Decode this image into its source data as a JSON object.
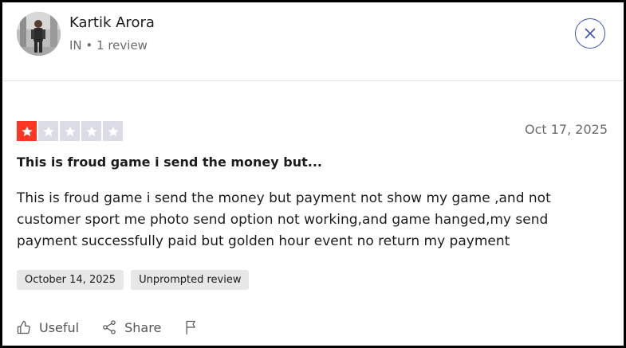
{
  "reviewer": {
    "name": "Kartik Arora",
    "meta": "IN • 1 review",
    "avatar_icon": "person-photo"
  },
  "close_icon": "close-icon",
  "rating": {
    "stars": 1,
    "max": 5,
    "filled_color": "#ff3722",
    "empty_color": "#dcdce6"
  },
  "review": {
    "date": "Oct 17, 2025",
    "title": "This is froud game i send the money but...",
    "body": "This is froud game i send the money but payment not show my game ,and not customer sport me photo send option not working,and game hanged,my send payment successfully paid but golden hour event no return my payment"
  },
  "tags": {
    "experience_date": "October 14, 2025",
    "review_type": "Unprompted review"
  },
  "actions": {
    "useful_label": "Useful",
    "share_label": "Share",
    "useful_icon": "thumbs-up-icon",
    "share_icon": "share-icon",
    "report_icon": "flag-icon"
  },
  "colors": {
    "accent": "#3a54b0",
    "text": "#1c1c1c",
    "muted": "#6b6b6b"
  }
}
